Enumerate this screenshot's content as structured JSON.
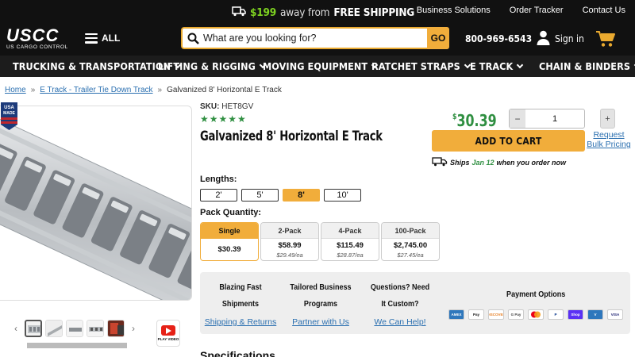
{
  "topbar": {
    "promo_amount": "$199",
    "promo_text": "away from",
    "promo_strong": "FREE SHIPPING",
    "links": [
      "Business Solutions",
      "Order Tracker",
      "Contact Us"
    ]
  },
  "header": {
    "logo": "USCC",
    "logo_sub": "US CARGO CONTROL",
    "menu_label": "ALL",
    "search_placeholder": "What are you looking for?",
    "search_button": "GO",
    "phone": "800-969-6543",
    "signin": "Sign in"
  },
  "nav": {
    "items": [
      "TRUCKING & TRANSPORTATION",
      "LIFTING & RIGGING",
      "MOVING EQUIPMENT",
      "RATCHET STRAPS",
      "E TRACK",
      "CHAIN & BINDERS"
    ]
  },
  "breadcrumb": {
    "home": "Home",
    "category": "E Track - Trailer Tie Down Track",
    "current": "Galvanized 8' Horizontal E Track",
    "sep": "»"
  },
  "badge": {
    "line1": "USA",
    "line2": "MADE"
  },
  "video": {
    "label": "PLAY VIDEO"
  },
  "product": {
    "sku_label": "SKU:",
    "sku": "HET8GV",
    "stars": "★★★★★",
    "title": "Galvanized 8' Horizontal E Track",
    "price_currency": "$",
    "price": "30.39",
    "qty": "1",
    "minus": "−",
    "plus": "+",
    "add_to_cart": "ADD TO CART",
    "bulk": "Request Bulk Pricing",
    "ships_word": "Ships",
    "ships_date": "Jan 12",
    "ships_tail": "when you order now",
    "lengths_label": "Lengths:",
    "lengths": [
      "2'",
      "5'",
      "8'",
      "10'"
    ],
    "selected_length": "8'",
    "pack_label": "Pack Quantity:",
    "packs": [
      {
        "name": "Single",
        "price": "$30.39",
        "each": ""
      },
      {
        "name": "2-Pack",
        "price": "$58.99",
        "each": "$29.49/ea"
      },
      {
        "name": "4-Pack",
        "price": "$115.49",
        "each": "$28.87/ea"
      },
      {
        "name": "100-Pack",
        "price": "$2,745.00",
        "each": "$27.45/ea"
      }
    ]
  },
  "info": {
    "shipping_title": "Blazing Fast Shipments",
    "shipping_link": "Shipping & Returns",
    "business_title": "Tailored Business Programs",
    "business_link": "Partner with Us",
    "questions_title": "Questions? Need It Custom?",
    "questions_link": "We Can Help!",
    "payment_title": "Payment Options",
    "payments": [
      "AMEX",
      "Pay",
      "DISCOVER",
      "G Pay",
      "MC",
      "P",
      "Shop",
      "V",
      "VISA"
    ]
  },
  "section_heading": "Specifications",
  "colors": {
    "accent": "#f1ad3b",
    "green": "#2f8f41",
    "link": "#2a6fb0",
    "dark": "#111111"
  }
}
